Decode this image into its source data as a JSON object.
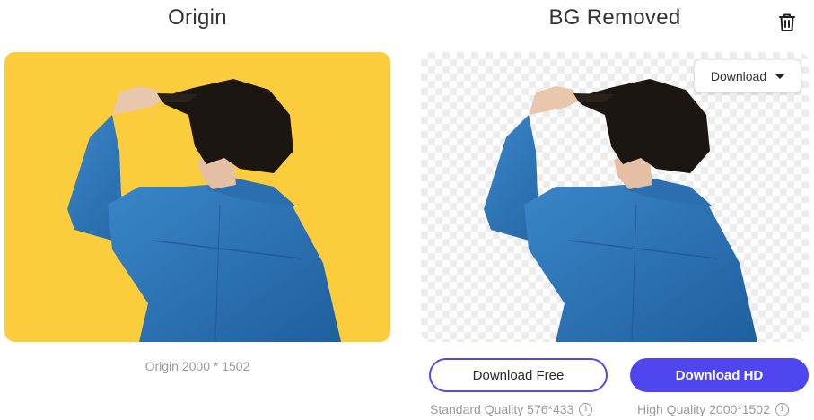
{
  "origin": {
    "title": "Origin",
    "meta_label": "Origin 2000 * 1502",
    "background_color": "#f9c733"
  },
  "removed": {
    "title": "BG Removed",
    "delete_icon": "trash-icon",
    "dropdown": {
      "label": "Download",
      "icon": "caret-down-icon"
    }
  },
  "actions": {
    "free": {
      "label": "Download Free",
      "quality": "Standard Quality 576*433",
      "info_icon": "info-icon"
    },
    "hd": {
      "label": "Download HD",
      "quality": "High Quality 2000*1502",
      "info_icon": "info-icon"
    }
  },
  "colors": {
    "accent": "#4f46f0",
    "accent_border": "#5649e5",
    "text_muted": "#9a9a9a",
    "title": "#333333"
  }
}
